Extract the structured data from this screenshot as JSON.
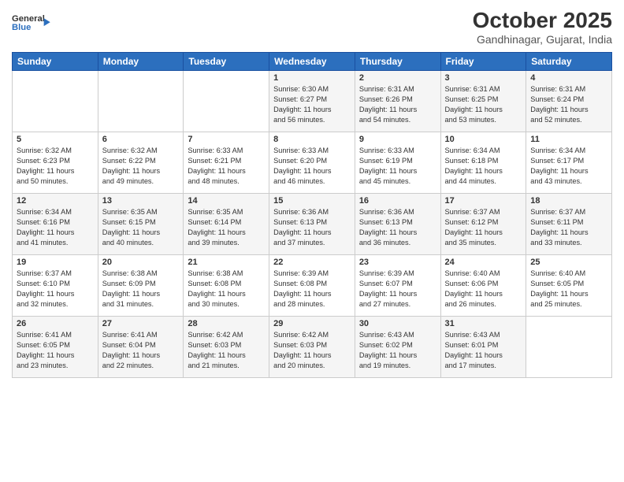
{
  "header": {
    "logo_general": "General",
    "logo_blue": "Blue",
    "title": "October 2025",
    "location": "Gandhinagar, Gujarat, India"
  },
  "days_of_week": [
    "Sunday",
    "Monday",
    "Tuesday",
    "Wednesday",
    "Thursday",
    "Friday",
    "Saturday"
  ],
  "weeks": [
    [
      {
        "day": "",
        "info": ""
      },
      {
        "day": "",
        "info": ""
      },
      {
        "day": "",
        "info": ""
      },
      {
        "day": "1",
        "info": "Sunrise: 6:30 AM\nSunset: 6:27 PM\nDaylight: 11 hours\nand 56 minutes."
      },
      {
        "day": "2",
        "info": "Sunrise: 6:31 AM\nSunset: 6:26 PM\nDaylight: 11 hours\nand 54 minutes."
      },
      {
        "day": "3",
        "info": "Sunrise: 6:31 AM\nSunset: 6:25 PM\nDaylight: 11 hours\nand 53 minutes."
      },
      {
        "day": "4",
        "info": "Sunrise: 6:31 AM\nSunset: 6:24 PM\nDaylight: 11 hours\nand 52 minutes."
      }
    ],
    [
      {
        "day": "5",
        "info": "Sunrise: 6:32 AM\nSunset: 6:23 PM\nDaylight: 11 hours\nand 50 minutes."
      },
      {
        "day": "6",
        "info": "Sunrise: 6:32 AM\nSunset: 6:22 PM\nDaylight: 11 hours\nand 49 minutes."
      },
      {
        "day": "7",
        "info": "Sunrise: 6:33 AM\nSunset: 6:21 PM\nDaylight: 11 hours\nand 48 minutes."
      },
      {
        "day": "8",
        "info": "Sunrise: 6:33 AM\nSunset: 6:20 PM\nDaylight: 11 hours\nand 46 minutes."
      },
      {
        "day": "9",
        "info": "Sunrise: 6:33 AM\nSunset: 6:19 PM\nDaylight: 11 hours\nand 45 minutes."
      },
      {
        "day": "10",
        "info": "Sunrise: 6:34 AM\nSunset: 6:18 PM\nDaylight: 11 hours\nand 44 minutes."
      },
      {
        "day": "11",
        "info": "Sunrise: 6:34 AM\nSunset: 6:17 PM\nDaylight: 11 hours\nand 43 minutes."
      }
    ],
    [
      {
        "day": "12",
        "info": "Sunrise: 6:34 AM\nSunset: 6:16 PM\nDaylight: 11 hours\nand 41 minutes."
      },
      {
        "day": "13",
        "info": "Sunrise: 6:35 AM\nSunset: 6:15 PM\nDaylight: 11 hours\nand 40 minutes."
      },
      {
        "day": "14",
        "info": "Sunrise: 6:35 AM\nSunset: 6:14 PM\nDaylight: 11 hours\nand 39 minutes."
      },
      {
        "day": "15",
        "info": "Sunrise: 6:36 AM\nSunset: 6:13 PM\nDaylight: 11 hours\nand 37 minutes."
      },
      {
        "day": "16",
        "info": "Sunrise: 6:36 AM\nSunset: 6:13 PM\nDaylight: 11 hours\nand 36 minutes."
      },
      {
        "day": "17",
        "info": "Sunrise: 6:37 AM\nSunset: 6:12 PM\nDaylight: 11 hours\nand 35 minutes."
      },
      {
        "day": "18",
        "info": "Sunrise: 6:37 AM\nSunset: 6:11 PM\nDaylight: 11 hours\nand 33 minutes."
      }
    ],
    [
      {
        "day": "19",
        "info": "Sunrise: 6:37 AM\nSunset: 6:10 PM\nDaylight: 11 hours\nand 32 minutes."
      },
      {
        "day": "20",
        "info": "Sunrise: 6:38 AM\nSunset: 6:09 PM\nDaylight: 11 hours\nand 31 minutes."
      },
      {
        "day": "21",
        "info": "Sunrise: 6:38 AM\nSunset: 6:08 PM\nDaylight: 11 hours\nand 30 minutes."
      },
      {
        "day": "22",
        "info": "Sunrise: 6:39 AM\nSunset: 6:08 PM\nDaylight: 11 hours\nand 28 minutes."
      },
      {
        "day": "23",
        "info": "Sunrise: 6:39 AM\nSunset: 6:07 PM\nDaylight: 11 hours\nand 27 minutes."
      },
      {
        "day": "24",
        "info": "Sunrise: 6:40 AM\nSunset: 6:06 PM\nDaylight: 11 hours\nand 26 minutes."
      },
      {
        "day": "25",
        "info": "Sunrise: 6:40 AM\nSunset: 6:05 PM\nDaylight: 11 hours\nand 25 minutes."
      }
    ],
    [
      {
        "day": "26",
        "info": "Sunrise: 6:41 AM\nSunset: 6:05 PM\nDaylight: 11 hours\nand 23 minutes."
      },
      {
        "day": "27",
        "info": "Sunrise: 6:41 AM\nSunset: 6:04 PM\nDaylight: 11 hours\nand 22 minutes."
      },
      {
        "day": "28",
        "info": "Sunrise: 6:42 AM\nSunset: 6:03 PM\nDaylight: 11 hours\nand 21 minutes."
      },
      {
        "day": "29",
        "info": "Sunrise: 6:42 AM\nSunset: 6:03 PM\nDaylight: 11 hours\nand 20 minutes."
      },
      {
        "day": "30",
        "info": "Sunrise: 6:43 AM\nSunset: 6:02 PM\nDaylight: 11 hours\nand 19 minutes."
      },
      {
        "day": "31",
        "info": "Sunrise: 6:43 AM\nSunset: 6:01 PM\nDaylight: 11 hours\nand 17 minutes."
      },
      {
        "day": "",
        "info": ""
      }
    ]
  ]
}
